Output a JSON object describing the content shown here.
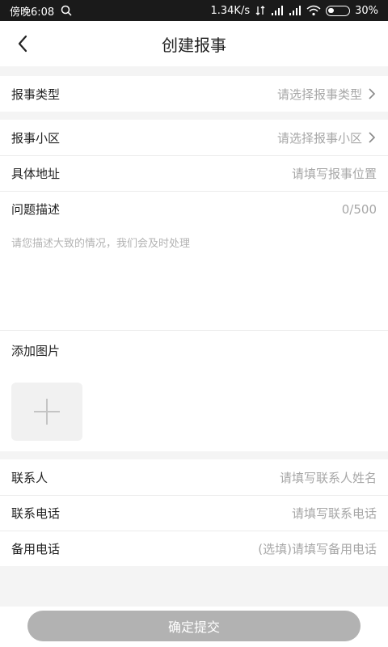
{
  "status_bar": {
    "time": "傍晚6:08",
    "net_speed": "1.34K/s",
    "battery": "30%",
    "battery_level": 0.3,
    "icons": [
      "search-icon",
      "data-icon",
      "signal-icon",
      "signal-icon",
      "wifi-icon",
      "battery-icon"
    ]
  },
  "header": {
    "title": "创建报事",
    "back_icon": "back-arrow-icon"
  },
  "form": {
    "type": {
      "label": "报事类型",
      "placeholder": "请选择报事类型"
    },
    "community": {
      "label": "报事小区",
      "placeholder": "请选择报事小区"
    },
    "address": {
      "label": "具体地址",
      "placeholder": "请填写报事位置"
    },
    "description": {
      "label": "问题描述",
      "counter": "0/500",
      "placeholder": "请您描述大致的情况，我们会及时处理"
    },
    "images": {
      "label": "添加图片",
      "add_icon": "plus-icon"
    },
    "contact": {
      "label": "联系人",
      "placeholder": "请填写联系人姓名"
    },
    "phone": {
      "label": "联系电话",
      "placeholder": "请填写联系电话"
    },
    "backup_phone": {
      "label": "备用电话",
      "placeholder": "(选填)请填写备用电话"
    }
  },
  "submit": {
    "label": "确定提交"
  },
  "colors": {
    "placeholder": "#a7a7a7",
    "button": "#b2b2b2",
    "background": "#f4f4f4"
  }
}
